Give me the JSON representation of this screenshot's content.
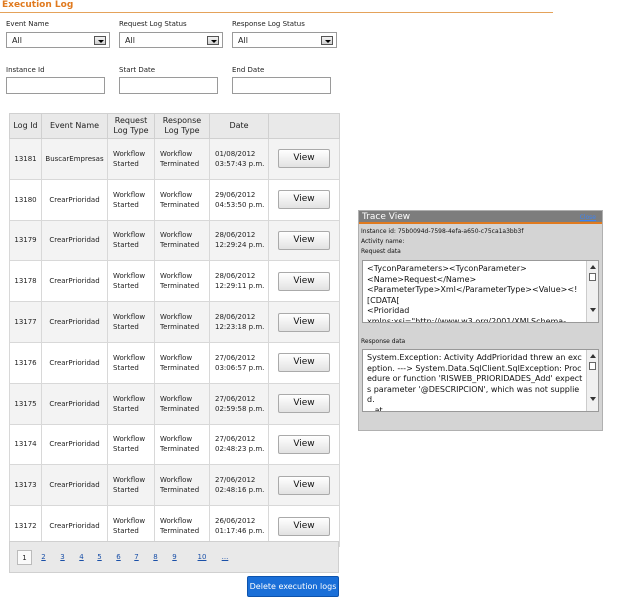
{
  "page": {
    "title": "Execution Log"
  },
  "filters": {
    "event_name": {
      "label": "Event Name",
      "value": "All"
    },
    "request_status": {
      "label": "Request Log Status",
      "value": "All"
    },
    "response_status": {
      "label": "Response Log Status",
      "value": "All"
    },
    "instance_id": {
      "label": "Instance Id",
      "value": ""
    },
    "start_date": {
      "label": "Start Date",
      "value": ""
    },
    "end_date": {
      "label": "End Date",
      "value": ""
    }
  },
  "table": {
    "headers": [
      "Log Id",
      "Event Name",
      "Request Log Type",
      "Response Log Type",
      "Date",
      ""
    ],
    "rows": [
      {
        "id": "13181",
        "event": "BuscarEmpresas",
        "req": "Workflow Started",
        "resp": "Workflow Terminated",
        "date": "01/08/2012 03:57:43 p.m.",
        "action": "View"
      },
      {
        "id": "13180",
        "event": "CrearPrioridad",
        "req": "Workflow Started",
        "resp": "Workflow Terminated",
        "date": "29/06/2012 04:53:50 p.m.",
        "action": "View"
      },
      {
        "id": "13179",
        "event": "CrearPrioridad",
        "req": "Workflow Started",
        "resp": "Workflow Terminated",
        "date": "28/06/2012 12:29:24 p.m.",
        "action": "View"
      },
      {
        "id": "13178",
        "event": "CrearPrioridad",
        "req": "Workflow Started",
        "resp": "Workflow Terminated",
        "date": "28/06/2012 12:29:11 p.m.",
        "action": "View"
      },
      {
        "id": "13177",
        "event": "CrearPrioridad",
        "req": "Workflow Started",
        "resp": "Workflow Terminated",
        "date": "28/06/2012 12:23:18 p.m.",
        "action": "View"
      },
      {
        "id": "13176",
        "event": "CrearPrioridad",
        "req": "Workflow Started",
        "resp": "Workflow Terminated",
        "date": "27/06/2012 03:06:57 p.m.",
        "action": "View"
      },
      {
        "id": "13175",
        "event": "CrearPrioridad",
        "req": "Workflow Started",
        "resp": "Workflow Terminated",
        "date": "27/06/2012 02:59:58 p.m.",
        "action": "View"
      },
      {
        "id": "13174",
        "event": "CrearPrioridad",
        "req": "Workflow Started",
        "resp": "Workflow Terminated",
        "date": "27/06/2012 02:48:23 p.m.",
        "action": "View"
      },
      {
        "id": "13173",
        "event": "CrearPrioridad",
        "req": "Workflow Started",
        "resp": "Workflow Terminated",
        "date": "27/06/2012 02:48:16 p.m.",
        "action": "View"
      },
      {
        "id": "13172",
        "event": "CrearPrioridad",
        "req": "Workflow Started",
        "resp": "Workflow Terminated",
        "date": "26/06/2012 01:17:46 p.m.",
        "action": "View"
      }
    ]
  },
  "pager": {
    "current": "1",
    "pages": [
      "2",
      "3",
      "4",
      "5",
      "6",
      "7",
      "8",
      "9",
      "10",
      "..."
    ]
  },
  "delete_button": "Delete execution logs",
  "trace": {
    "title": "Trace View",
    "close": "Close",
    "instance_line": "Instance id: 75b0094d-7598-4efa-a650-c75ca1a3bb3f",
    "activity_line": "Activity name:",
    "request_label": "Request data",
    "request_text": "<TyconParameters><TyconParameter>\n<Name>Request</Name>\n<ParameterType>Xml</ParameterType><Value><![CDATA[\n<Prioridad\nxmlns:xsi=\"http://www.w3.org/2001/XMLSchema-",
    "response_label": "Response data",
    "response_text": "System.Exception: Activity AddPrioridad threw an exception. ---> System.Data.SqlClient.SqlException: Procedure or function 'RISWEB_PRIORIDADES_Add' expects parameter '@DESCRIPCION', which was not supplied.\n   at"
  },
  "colors": {
    "accent": "#e07a1f",
    "link": "#1a50a8",
    "primary_button": "#1a6fd8"
  }
}
